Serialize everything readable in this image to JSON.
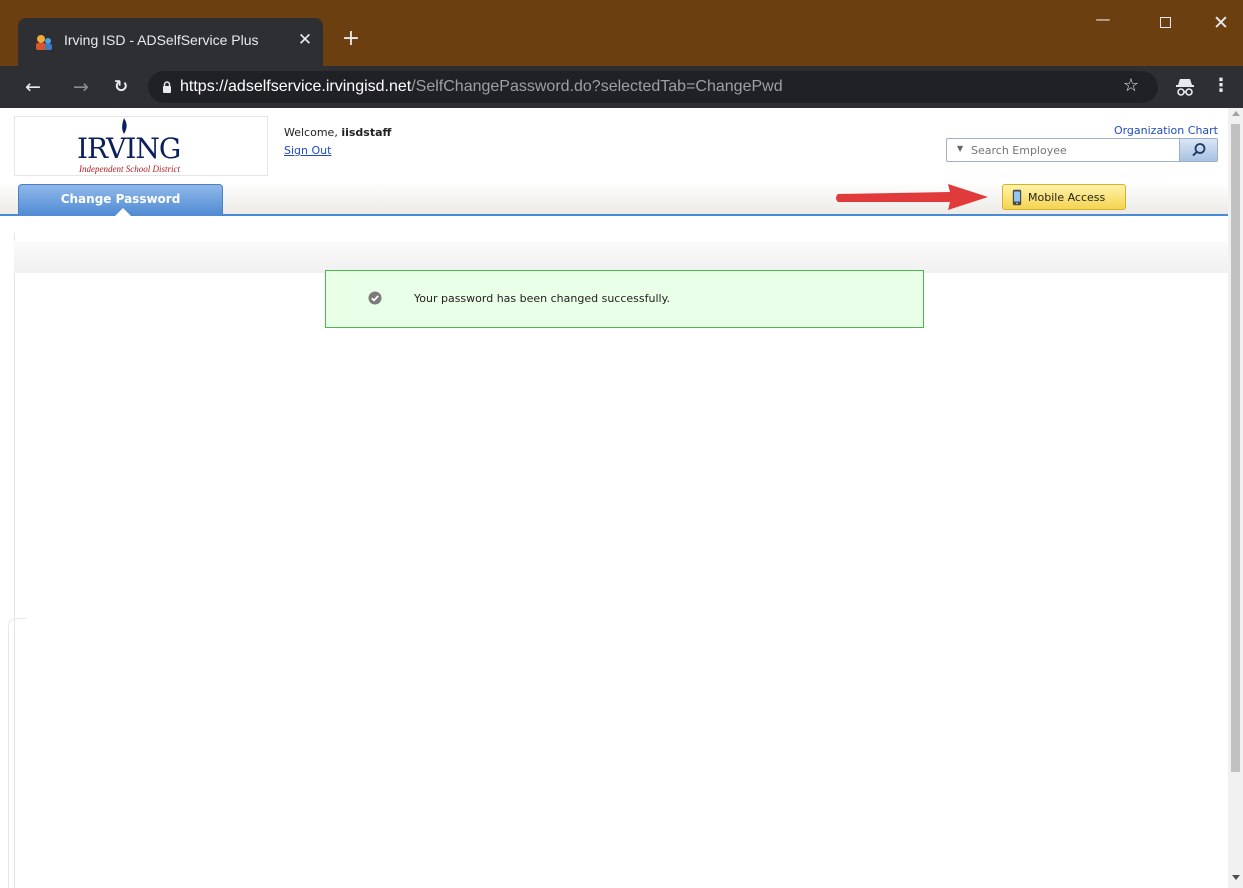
{
  "browser": {
    "tab_title": "Irving ISD - ADSelfService Plus",
    "tab_close": "✕",
    "new_tab": "+",
    "url_scheme": "https://",
    "url_host": "adselfservice.irvingisd.net",
    "url_path": "/SelfChangePassword.do?selectedTab=ChangePwd",
    "icons": [
      "favicon-icon",
      "close-icon",
      "plus-icon",
      "back-arrow-icon",
      "forward-arrow-icon",
      "reload-icon",
      "lock-icon",
      "star-icon",
      "incognito-icon",
      "kebab-menu-icon",
      "minimize-icon",
      "maximize-icon",
      "close-window-icon"
    ]
  },
  "header": {
    "logo_word": "IRVING",
    "logo_subtitle": "Independent School District",
    "welcome_prefix": "Welcome, ",
    "username": "iisdstaff",
    "sign_out": "Sign Out",
    "org_chart": "Organization Chart",
    "search_placeholder": "Search Employee"
  },
  "nav": {
    "active_tab": "Change Password",
    "mobile_access": "Mobile Access"
  },
  "message": {
    "text": "Your password has been changed successfully."
  },
  "colors": {
    "titlebar": "#6b3f10",
    "tab_blue": "#4f8ad3",
    "success_bg": "#eaffe8",
    "success_border": "#4ab84a",
    "annotation_arrow": "#e03a3a",
    "mobile_button": "#f5d452"
  }
}
